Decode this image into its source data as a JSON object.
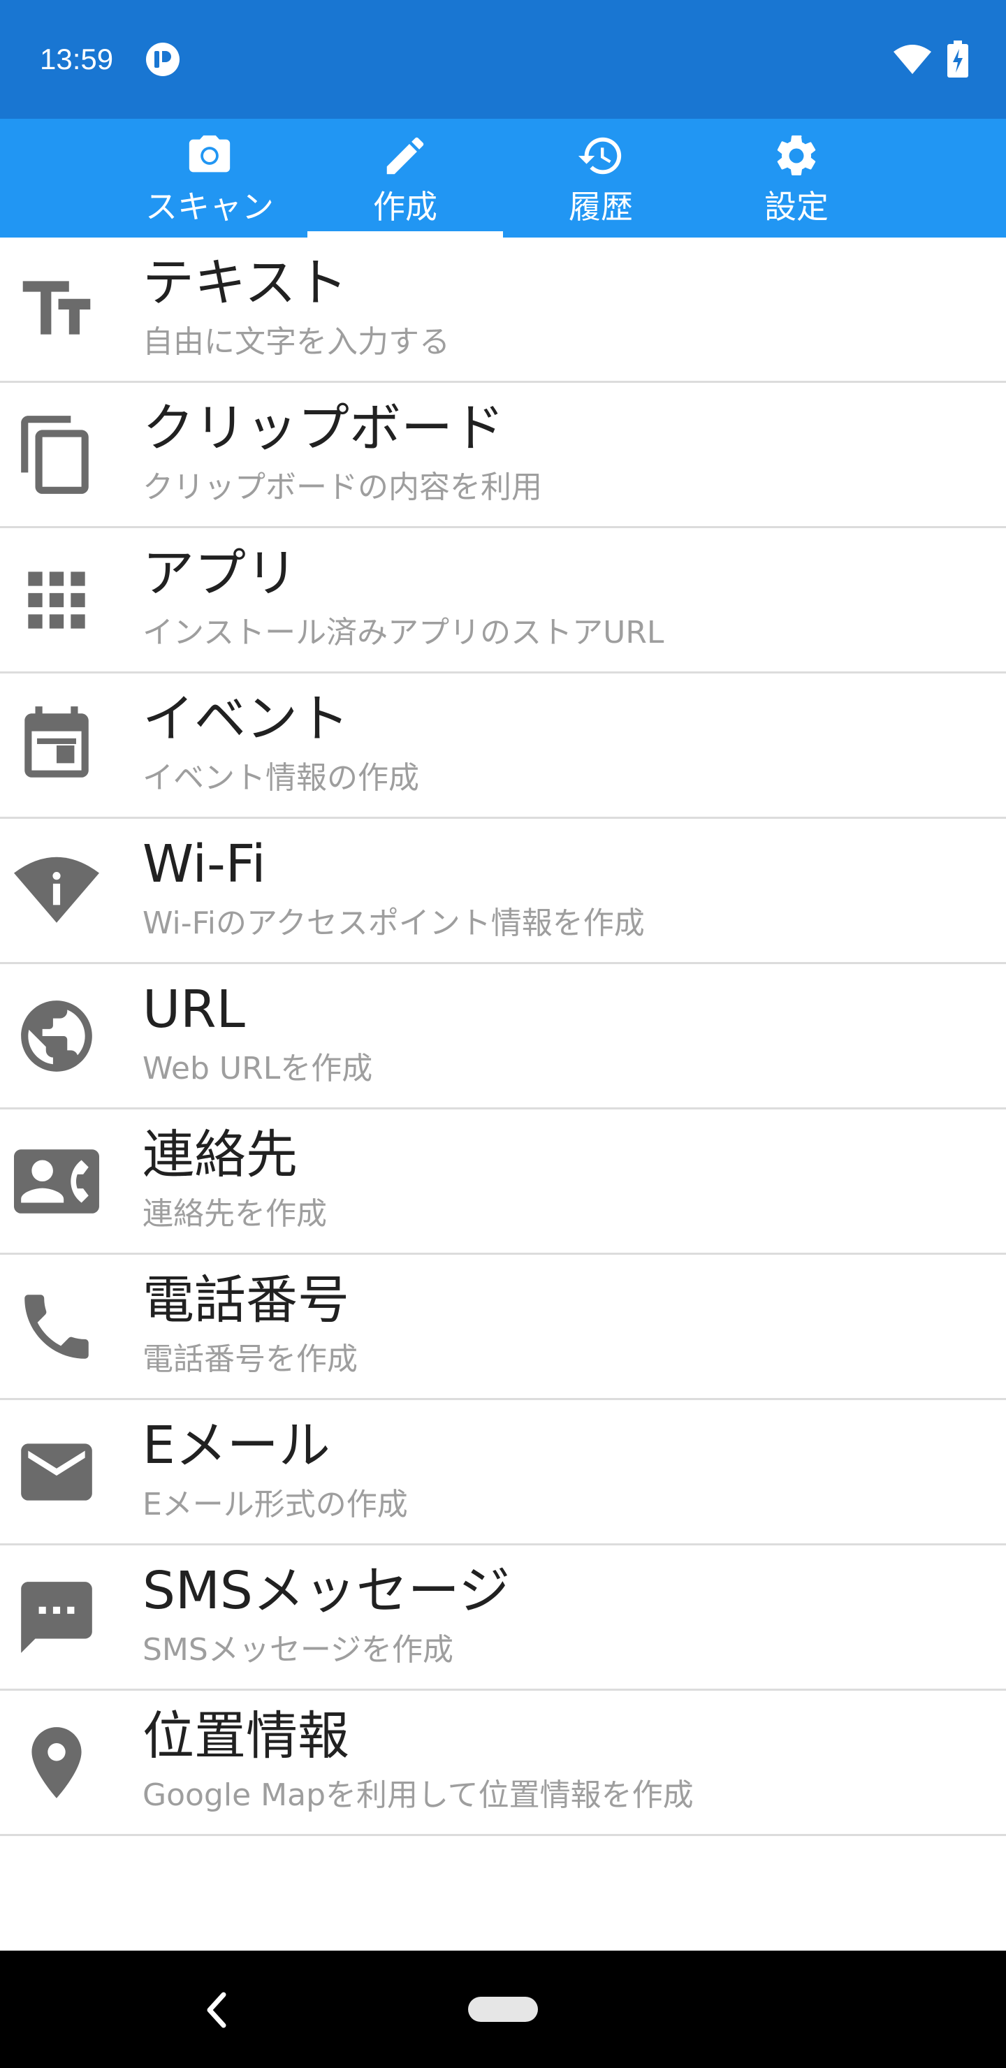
{
  "status_bar": {
    "time": "13:59"
  },
  "tabs": [
    {
      "label": "スキャン",
      "icon": "camera-icon"
    },
    {
      "label": "作成",
      "icon": "pencil-icon",
      "active": true
    },
    {
      "label": "履歴",
      "icon": "history-icon"
    },
    {
      "label": "設定",
      "icon": "gear-icon"
    }
  ],
  "items": [
    {
      "title": "テキスト",
      "subtitle": "自由に文字を入力する",
      "icon": "text-fields-icon"
    },
    {
      "title": "クリップボード",
      "subtitle": "クリップボードの内容を利用",
      "icon": "copy-icon"
    },
    {
      "title": "アプリ",
      "subtitle": "インストール済みアプリのストアURL",
      "icon": "apps-grid-icon"
    },
    {
      "title": "イベント",
      "subtitle": "イベント情報の作成",
      "icon": "event-icon"
    },
    {
      "title": "Wi-Fi",
      "subtitle": "Wi-Fiのアクセスポイント情報を作成",
      "icon": "wifi-info-icon"
    },
    {
      "title": "URL",
      "subtitle": "Web URLを作成",
      "icon": "globe-icon"
    },
    {
      "title": "連絡先",
      "subtitle": "連絡先を作成",
      "icon": "contact-phone-icon"
    },
    {
      "title": "電話番号",
      "subtitle": "電話番号を作成",
      "icon": "phone-icon"
    },
    {
      "title": "Eメール",
      "subtitle": "Eメール形式の作成",
      "icon": "mail-icon"
    },
    {
      "title": "SMSメッセージ",
      "subtitle": "SMSメッセージを作成",
      "icon": "sms-icon"
    },
    {
      "title": "位置情報",
      "subtitle": "Google Mapを利用して位置情報を作成",
      "icon": "location-pin-icon"
    }
  ],
  "colors": {
    "status_bar": "#1976d2",
    "tab_bar": "#2196f3",
    "icon_gray": "#6b6b6b",
    "subtitle_gray": "#9e9e9e"
  }
}
